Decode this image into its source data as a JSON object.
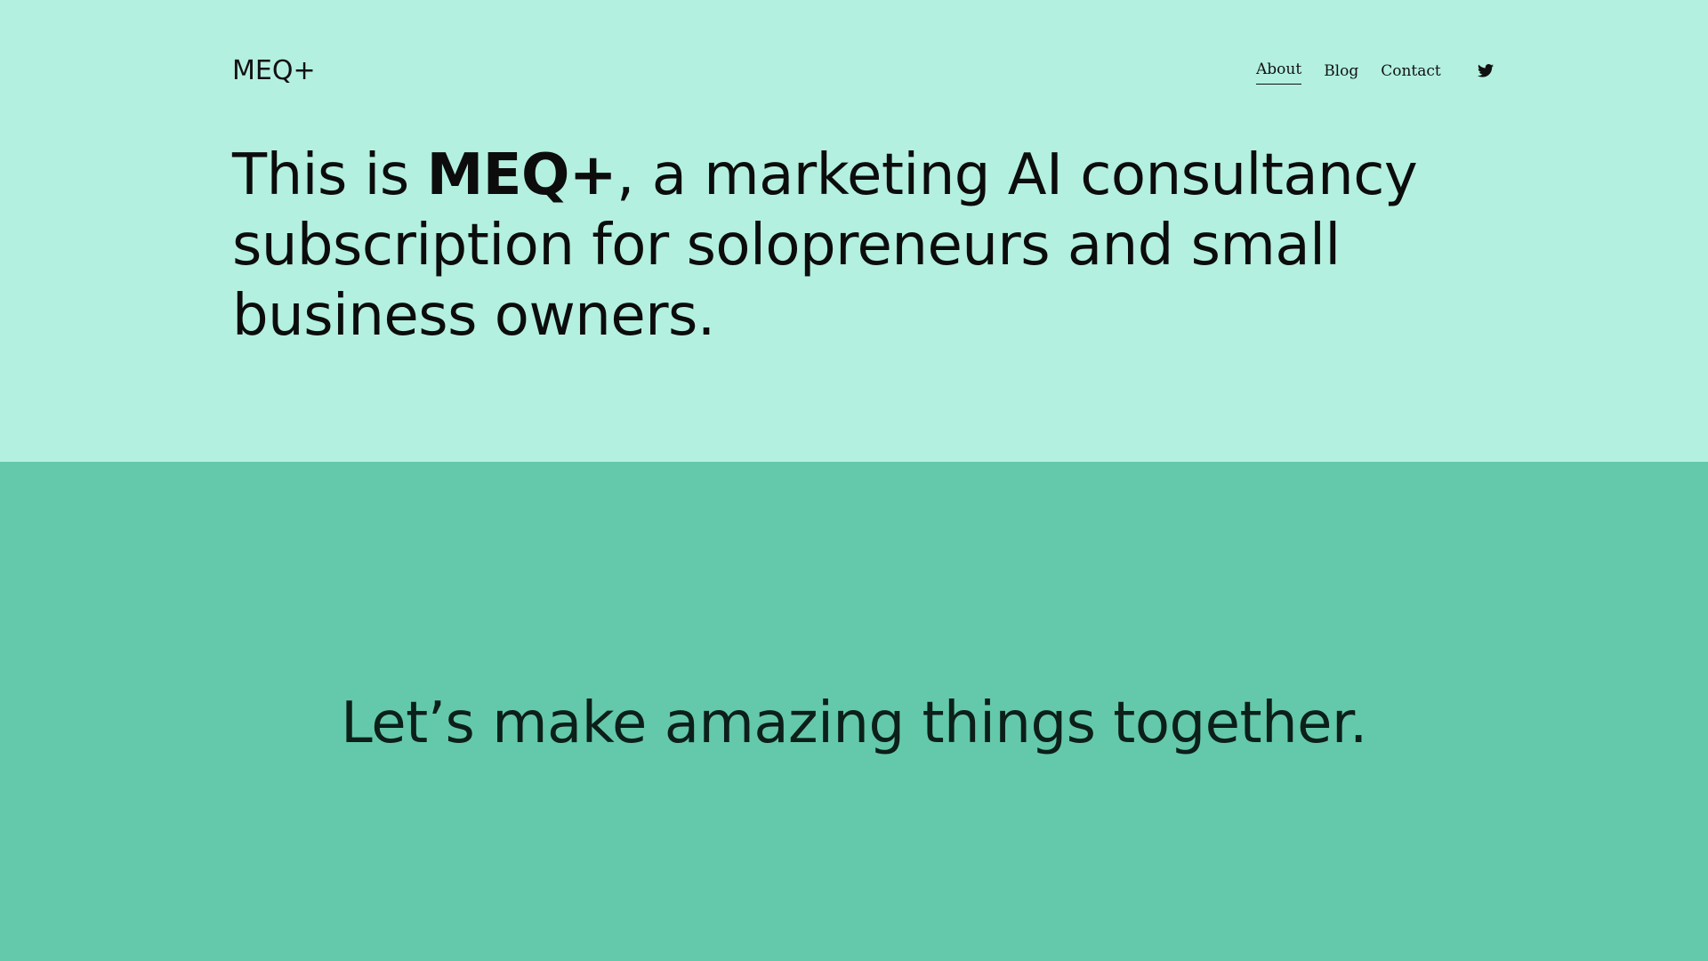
{
  "header": {
    "brand": "MEQ+",
    "nav": [
      {
        "label": "About",
        "active": true
      },
      {
        "label": "Blog",
        "active": false
      },
      {
        "label": "Contact",
        "active": false
      }
    ],
    "social_icon": "twitter-icon"
  },
  "hero": {
    "headline_prefix": "This is ",
    "headline_brand": "MEQ+",
    "headline_suffix": ", a marketing AI consultancy subscription for solopreneurs and small business owners."
  },
  "cta": {
    "text": "Let’s make amazing things together."
  },
  "colors": {
    "hero_background": "#b3f0df",
    "cta_background": "#64c9ab",
    "text": "#111111"
  }
}
